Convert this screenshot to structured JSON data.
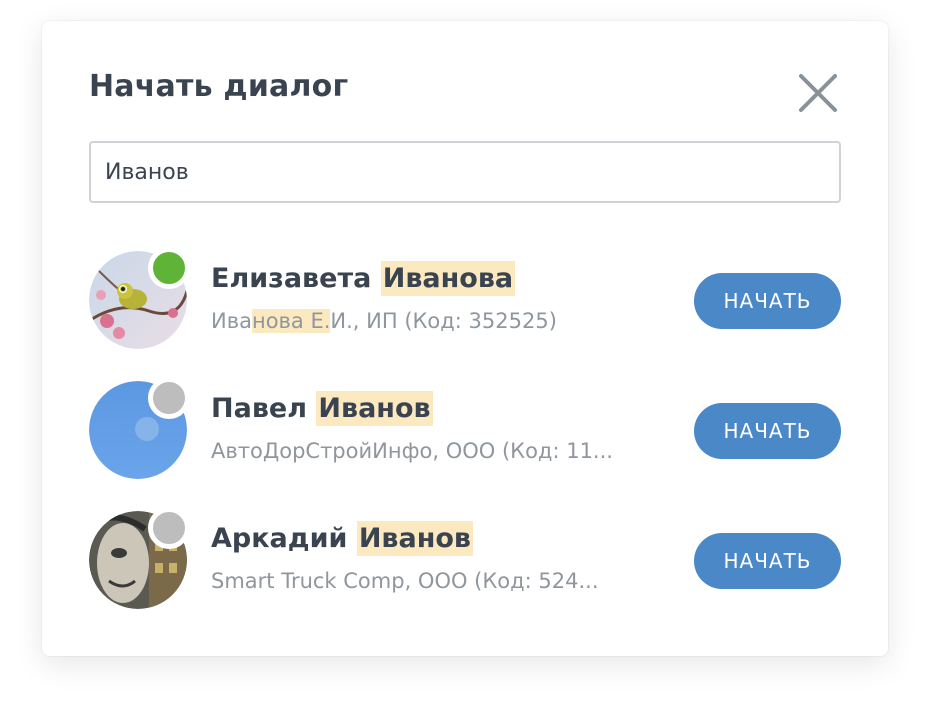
{
  "dialog": {
    "title": "Начать диалог",
    "close_icon": "close-icon"
  },
  "search": {
    "value": "Иванов",
    "placeholder": ""
  },
  "colors": {
    "online": "#5fb336",
    "offline": "#bdbdbd",
    "button": "#4a88c8",
    "highlight": "#fde9bf"
  },
  "contacts": [
    {
      "first_name": "Елизавета",
      "last_name": "Иванова",
      "subtitle_pre": "Ива",
      "subtitle_hl": "нова Е.",
      "subtitle_post": "И., ИП (Код: 352525)",
      "status": "online",
      "button_label": "НАЧАТЬ"
    },
    {
      "first_name": "Павел",
      "last_name": "Иванов",
      "subtitle": "АвтоДорСтройИнфо, ООО (Код: 11...",
      "status": "offline",
      "button_label": "НАЧАТЬ"
    },
    {
      "first_name": "Аркадий",
      "last_name": "Иванов",
      "subtitle": "Smart Truck Comp, ООО (Код: 524...",
      "status": "offline",
      "button_label": "НАЧАТЬ"
    }
  ]
}
